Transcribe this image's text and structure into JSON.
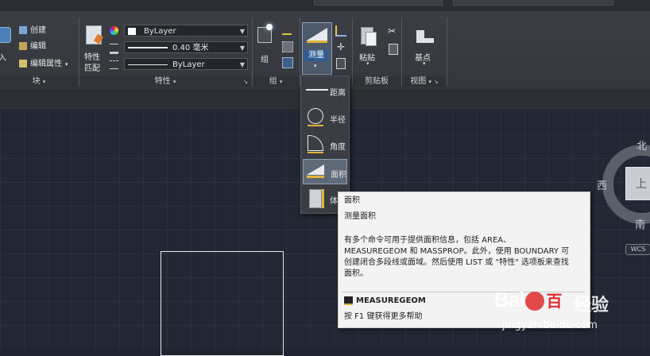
{
  "ribbon": {
    "block_panel": {
      "insert_label": "入",
      "create_label": "创建",
      "edit_label": "编辑",
      "edit_attr_label": "编辑属性",
      "title": "块"
    },
    "properties_panel": {
      "match_label_line1": "特性",
      "match_label_line2": "匹配",
      "color_value": "ByLayer",
      "lineweight_value": "0.40 毫米",
      "linetype_value": "ByLayer",
      "title": "特性"
    },
    "group_panel": {
      "group_label": "组",
      "title": "组"
    },
    "utilities_panel": {
      "measure_label": "测量"
    },
    "clipboard_panel": {
      "paste_label": "粘贴",
      "title": "剪贴板"
    },
    "view_panel": {
      "base_label": "基点",
      "title": "视图"
    }
  },
  "measure_dropdown": {
    "items": [
      {
        "label": "距离",
        "icon": "distance-icon"
      },
      {
        "label": "半径",
        "icon": "radius-icon"
      },
      {
        "label": "角度",
        "icon": "angle-icon"
      },
      {
        "label": "面积",
        "icon": "area-icon",
        "selected": true
      },
      {
        "label": "体",
        "icon": "volume-icon"
      }
    ]
  },
  "tooltip": {
    "title": "面积",
    "subtitle": "测量面积",
    "desc_line1": "有多个命令可用于提供面积信息，包括 AREA、",
    "desc_line2": "MEASUREGEOM 和 MASSPROP。此外，使用 BOUNDARY 可",
    "desc_line3": "创建闭合多段线或面域。然后使用 LIST 或 \"特性\" 选项板来查找",
    "desc_line4": "面积。",
    "command": "MEASUREGEOM",
    "help": "按 F1 键获得更多帮助"
  },
  "viewcube": {
    "north": "北",
    "west": "西",
    "south": "南",
    "face": "上",
    "wcs": "WCS"
  },
  "watermark": {
    "logo_text": "Bai",
    "logo_text2": "百",
    "brand": "经验",
    "url": "jingyan.baidu.com"
  },
  "colors": {
    "ribbon_bg": "#393c42",
    "canvas_bg": "#212733",
    "tooltip_bg": "#f3f3f3",
    "highlight": "#5f6a78",
    "baidu_red": "#de2b2b"
  }
}
